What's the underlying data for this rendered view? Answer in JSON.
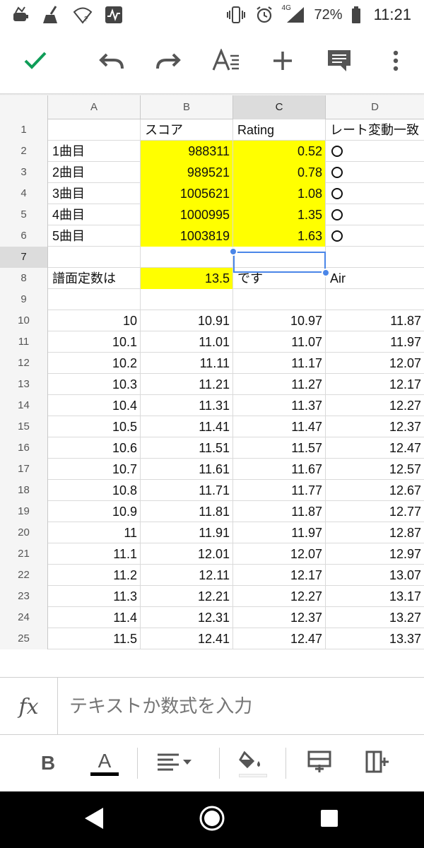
{
  "status_bar": {
    "network_label": "4G",
    "battery": "72%",
    "time": "11:21",
    "icons": [
      "notification-app-icon",
      "cleaner-icon",
      "wifi-question-icon",
      "activity-icon",
      "vibrate-icon",
      "alarm-icon",
      "signal-icon",
      "battery-icon"
    ]
  },
  "toolbar": {
    "icons": [
      "check-icon",
      "undo-icon",
      "redo-icon",
      "text-format-icon",
      "add-icon",
      "comment-icon",
      "more-vert-icon"
    ],
    "accent": "#0f9d58"
  },
  "grid": {
    "columns": [
      "A",
      "B",
      "C",
      "D"
    ],
    "selected_column": "C",
    "selected_row": "7",
    "rows": [
      {
        "num": "1",
        "a": "",
        "b": "スコア",
        "c": "Rating",
        "d": "レート変動一致"
      },
      {
        "num": "2",
        "a": "1曲目",
        "b": "988311",
        "c": "0.52",
        "d": "○"
      },
      {
        "num": "3",
        "a": "2曲目",
        "b": "989521",
        "c": "0.78",
        "d": "○"
      },
      {
        "num": "4",
        "a": "3曲目",
        "b": "1005621",
        "c": "1.08",
        "d": "○"
      },
      {
        "num": "5",
        "a": "4曲目",
        "b": "1000995",
        "c": "1.35",
        "d": "○"
      },
      {
        "num": "6",
        "a": "5曲目",
        "b": "1003819",
        "c": "1.63",
        "d": "○"
      },
      {
        "num": "7",
        "a": "",
        "b": "",
        "c": "",
        "d": ""
      },
      {
        "num": "8",
        "a": "譜面定数は",
        "b": "13.5",
        "c": "です",
        "d": "Air"
      },
      {
        "num": "9",
        "a": "",
        "b": "",
        "c": "",
        "d": ""
      },
      {
        "num": "10",
        "a": "10",
        "b": "10.91",
        "c": "10.97",
        "d": "11.87"
      },
      {
        "num": "11",
        "a": "10.1",
        "b": "11.01",
        "c": "11.07",
        "d": "11.97"
      },
      {
        "num": "12",
        "a": "10.2",
        "b": "11.11",
        "c": "11.17",
        "d": "12.07"
      },
      {
        "num": "13",
        "a": "10.3",
        "b": "11.21",
        "c": "11.27",
        "d": "12.17"
      },
      {
        "num": "14",
        "a": "10.4",
        "b": "11.31",
        "c": "11.37",
        "d": "12.27"
      },
      {
        "num": "15",
        "a": "10.5",
        "b": "11.41",
        "c": "11.47",
        "d": "12.37"
      },
      {
        "num": "16",
        "a": "10.6",
        "b": "11.51",
        "c": "11.57",
        "d": "12.47"
      },
      {
        "num": "17",
        "a": "10.7",
        "b": "11.61",
        "c": "11.67",
        "d": "12.57"
      },
      {
        "num": "18",
        "a": "10.8",
        "b": "11.71",
        "c": "11.77",
        "d": "12.67"
      },
      {
        "num": "19",
        "a": "10.9",
        "b": "11.81",
        "c": "11.87",
        "d": "12.77"
      },
      {
        "num": "20",
        "a": "11",
        "b": "11.91",
        "c": "11.97",
        "d": "12.87"
      },
      {
        "num": "21",
        "a": "11.1",
        "b": "12.01",
        "c": "12.07",
        "d": "12.97"
      },
      {
        "num": "22",
        "a": "11.2",
        "b": "12.11",
        "c": "12.17",
        "d": "13.07"
      },
      {
        "num": "23",
        "a": "11.3",
        "b": "12.21",
        "c": "12.27",
        "d": "13.17"
      },
      {
        "num": "24",
        "a": "11.4",
        "b": "12.31",
        "c": "12.37",
        "d": "13.27"
      },
      {
        "num": "25",
        "a": "11.5",
        "b": "12.41",
        "c": "12.47",
        "d": "13.37"
      }
    ],
    "highlight_color": "#ffff00",
    "selection_color": "#4a86e8"
  },
  "formula_bar": {
    "fx_label": "fx",
    "placeholder": "テキストか数式を入力"
  },
  "format_bar": {
    "bold_label": "B",
    "text_color_label": "A",
    "icons": [
      "bold-icon",
      "text-color-icon",
      "align-icon",
      "fill-color-icon",
      "insert-row-icon",
      "insert-column-icon"
    ]
  },
  "nav_bar": {
    "icons": [
      "back-icon",
      "home-icon",
      "recents-icon"
    ]
  }
}
